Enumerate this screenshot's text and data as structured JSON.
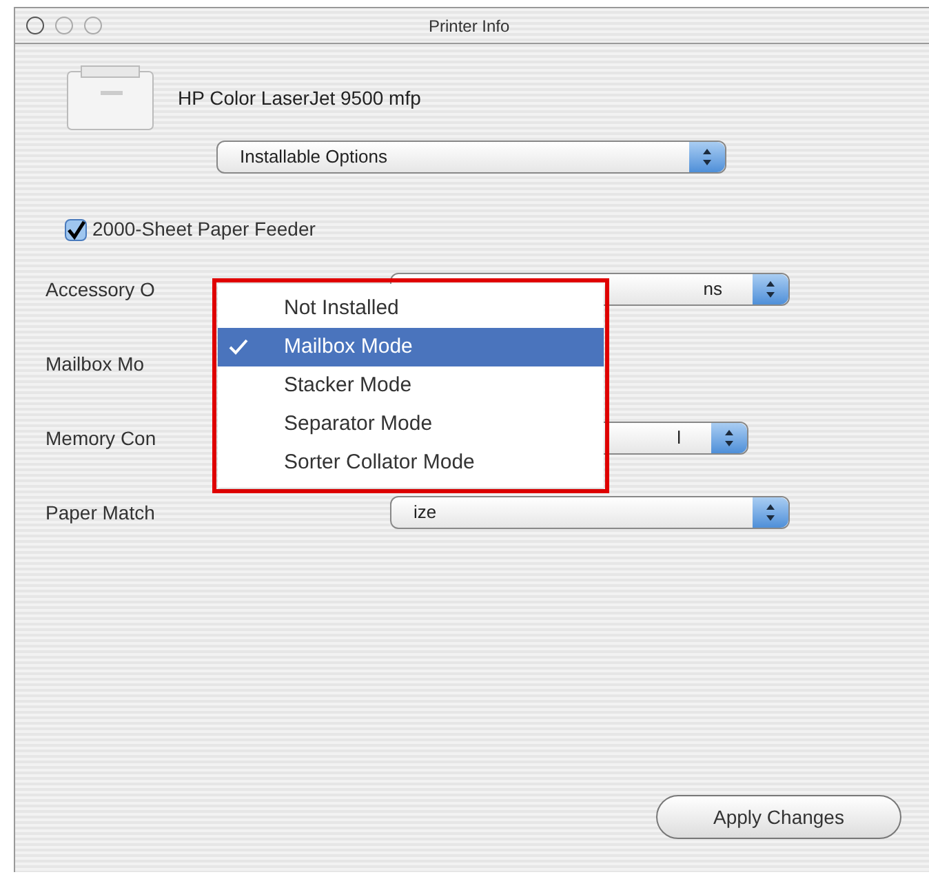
{
  "window": {
    "title": "Printer Info"
  },
  "printer": {
    "name": "HP Color LaserJet 9500 mfp"
  },
  "section_popup": {
    "value": "Installable Options"
  },
  "feeder": {
    "label": "2000-Sheet Paper Feeder",
    "checked": true
  },
  "options": [
    {
      "label": "Accessory O",
      "value": "ns"
    },
    {
      "label": "Mailbox Mo"
    },
    {
      "label": "Memory Con",
      "value": "l"
    },
    {
      "label": "Paper Match",
      "value": "ize"
    }
  ],
  "menu": {
    "items": [
      {
        "label": "Not Installed",
        "selected": false
      },
      {
        "label": "Mailbox Mode",
        "selected": true
      },
      {
        "label": "Stacker Mode",
        "selected": false
      },
      {
        "label": "Separator Mode",
        "selected": false
      },
      {
        "label": "Sorter Collator Mode",
        "selected": false
      }
    ]
  },
  "apply_button": "Apply Changes"
}
